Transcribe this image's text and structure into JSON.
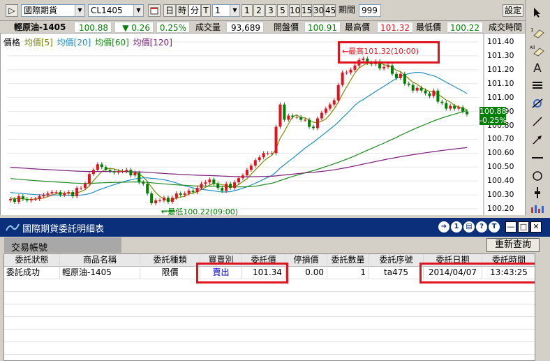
{
  "toolbar": {
    "play_glyph": "▷",
    "market": "國際期貨",
    "symbol": "CL1405",
    "btn_day": "日",
    "btn_hour": "時",
    "btn_minute": "分",
    "btn_tick": "T",
    "period_value": "1",
    "intervals": [
      "1",
      "2",
      "3",
      "5",
      "10",
      "15",
      "30",
      "45"
    ],
    "period_label": "期間",
    "period_count": "999",
    "settings": "設定"
  },
  "quote": {
    "name": "輕原油-1405",
    "last": "100.88",
    "change": "▼ 0.26",
    "change_pct": "0.25%",
    "volume_label": "成交量",
    "volume": "93,689",
    "open_label": "開盤價",
    "open": "100.91",
    "high_label": "最高價",
    "high": "101.32",
    "low_label": "最低價",
    "low": "100.22",
    "time_label": "成交時間"
  },
  "chart": {
    "legend": {
      "price": "價格",
      "ma5": "均價[5]",
      "ma20": "均價[20]",
      "ma60": "均價[60]",
      "ma120": "均價[120]"
    },
    "high_callout": "←最高101.32(10:00)",
    "low_callout": "←最低100.22(09:00)",
    "price_tag_value": "100.88",
    "price_tag_change": "-0.25%"
  },
  "chart_data": {
    "type": "candlestick",
    "yticks": [
      "101.40",
      "101.30",
      "101.20",
      "101.10",
      "101.00",
      "100.90",
      "100.80",
      "100.70",
      "100.60",
      "100.50",
      "100.40",
      "100.30",
      "100.20"
    ],
    "ylim": [
      100.2,
      101.4
    ],
    "series_names": [
      "價格",
      "均價[5]",
      "均價[20]",
      "均價[60]",
      "均價[120]"
    ],
    "colors": {
      "up": "#e0141e",
      "down": "#008000",
      "ma5": "#7a8c00",
      "ma20": "#1e8fc0",
      "ma60": "#1e8a1e",
      "ma120": "#7a1e7a"
    },
    "closes": [
      100.27,
      100.25,
      100.29,
      100.27,
      100.26,
      100.27,
      100.27,
      100.29,
      100.3,
      100.31,
      100.32,
      100.32,
      100.3,
      100.31,
      100.32,
      100.29,
      100.35,
      100.35,
      100.38,
      100.45,
      100.48,
      100.52,
      100.5,
      100.48,
      100.47,
      100.46,
      100.47,
      100.47,
      100.48,
      100.44,
      100.46,
      100.39,
      100.38,
      100.31,
      100.24,
      100.26,
      100.26,
      100.28,
      100.25,
      100.28,
      100.31,
      100.3,
      100.31,
      100.33,
      100.32,
      100.35,
      100.38,
      100.39,
      100.41,
      100.38,
      100.35,
      100.33,
      100.38,
      100.35,
      100.39,
      100.42,
      100.44,
      100.48,
      100.51,
      100.55,
      100.57,
      100.6,
      100.6,
      100.6,
      100.79,
      100.95,
      100.84,
      100.87,
      100.86,
      100.86,
      100.84,
      100.84,
      100.79,
      100.78,
      100.85,
      100.89,
      100.92,
      100.95,
      100.98,
      101.09,
      101.18,
      101.18,
      101.2,
      101.23,
      101.27,
      101.28,
      101.25,
      101.24,
      101.26,
      101.21,
      101.22,
      101.23,
      101.17,
      101.14,
      101.17,
      101.1,
      101.09,
      101.05,
      101.07,
      101.05,
      101.03,
      101.01,
      101.05,
      100.97,
      100.96,
      100.92,
      100.94,
      100.92,
      100.93,
      100.9,
      100.88
    ]
  },
  "orders_window": {
    "title": "國際期貨委託明細表",
    "circle_buttons": [
      "1",
      "T"
    ],
    "tab": "交易帳號",
    "refresh": "重新查詢",
    "columns": [
      "委託狀態",
      "商品名稱",
      "委託種類",
      "買賣別",
      "委託價",
      "停損價",
      "委託數量",
      "委託序號",
      "委託日期",
      "委託時間"
    ],
    "rows": [
      {
        "status": "委託成功",
        "product": "輕原油-1405",
        "type": "限價",
        "side": "賣出",
        "price": "101.34",
        "stop": "0.00",
        "qty": "1",
        "seq": "ta475",
        "date": "2014/04/07",
        "time": "13:43:25"
      }
    ]
  }
}
